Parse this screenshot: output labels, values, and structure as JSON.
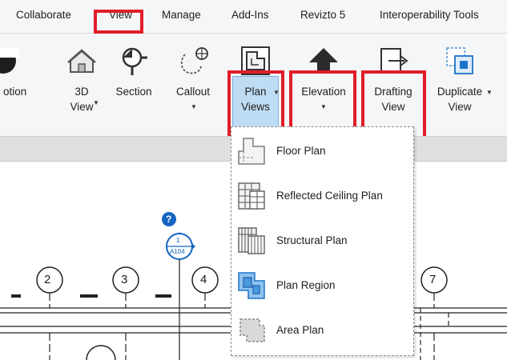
{
  "menubar": {
    "tabs": [
      "Collaborate",
      "View",
      "Manage",
      "Add-Ins",
      "Revizto 5",
      "Interoperability Tools"
    ],
    "active_tab": "View"
  },
  "ribbon": {
    "buttons": [
      {
        "line1": "otion",
        "line2": ""
      },
      {
        "line1": "3D",
        "line2": "View"
      },
      {
        "line1": "Section",
        "line2": ""
      },
      {
        "line1": "Callout",
        "line2": ""
      },
      {
        "line1": "Plan",
        "line2": "Views"
      },
      {
        "line1": "Elevation",
        "line2": ""
      },
      {
        "line1": "Drafting",
        "line2": "View"
      },
      {
        "line1": "Duplicate",
        "line2": "View"
      }
    ]
  },
  "plan_views_menu": {
    "items": [
      "Floor Plan",
      "Reflected Ceiling Plan",
      "Structural Plan",
      "Plan Region",
      "Area Plan"
    ]
  },
  "canvas": {
    "grid_labels": [
      "2",
      "3",
      "4",
      "7"
    ],
    "section_tag": {
      "number": "1",
      "sheet": "A104"
    },
    "help_mark": "?"
  },
  "colors": {
    "highlight": "#e01e2a",
    "plan_button_bg": "#bedcf4",
    "section_blue": "#1565c0"
  },
  "icons": [
    "home-icon",
    "section-icon",
    "callout-icon",
    "plan-views-icon",
    "elevation-icon",
    "drafting-view-icon",
    "duplicate-view-icon"
  ]
}
